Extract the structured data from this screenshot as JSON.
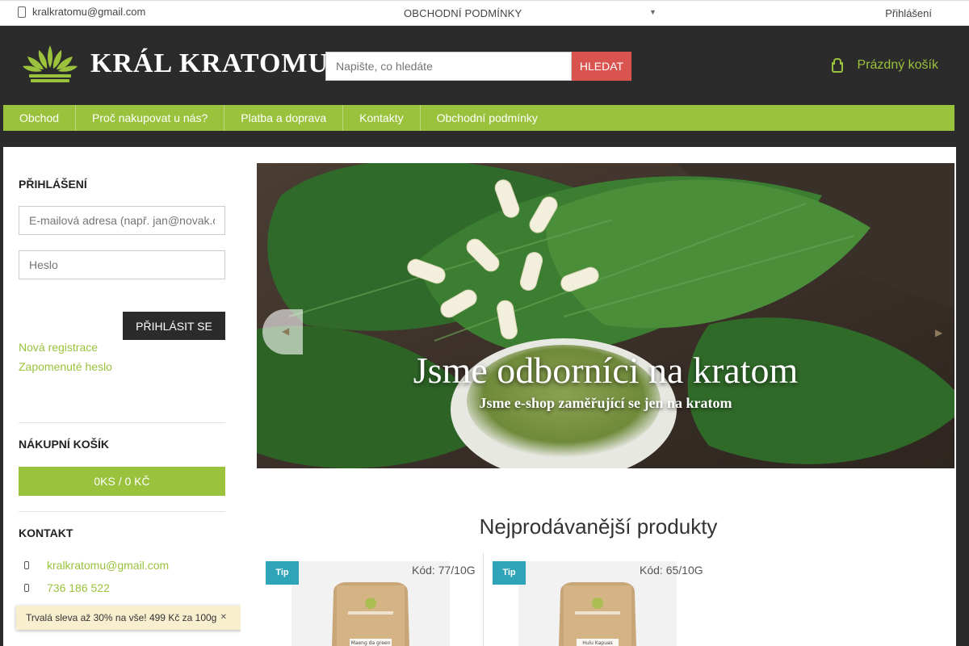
{
  "topbar": {
    "email": "kralkratomu@gmail.com",
    "terms": "OBCHODNÍ PODMÍNKY",
    "login": "Přihlášení"
  },
  "header": {
    "logo_text": "KRÁL KRATOMU",
    "search_placeholder": "Napište, co hledáte",
    "search_button": "HLEDAT",
    "cart_label": "Prázdný košík"
  },
  "nav": {
    "items": [
      "Obchod",
      "Proč nakupovat u nás?",
      "Platba a doprava",
      "Kontakty",
      "Obchodní podmínky"
    ]
  },
  "sidebar": {
    "login_title": "PŘIHLÁŠENÍ",
    "email_placeholder": "E-mailová adresa (např. jan@novak.cz)",
    "password_placeholder": "Heslo",
    "login_button": "PŘIHLÁSIT SE",
    "register_link": "Nová registrace",
    "forgot_link": "Zapomenuté heslo",
    "cart_title": "NÁKUPNÍ KOŠÍK",
    "cart_summary": "0KS / 0 KČ",
    "contact_title": "KONTAKT",
    "contact_email": "kralkratomu@gmail.com",
    "contact_phone": "736 186 522"
  },
  "promo": {
    "text": "Trvalá sleva až 30% na vše! 499 Kč za 100g"
  },
  "banner": {
    "title": "Jsme odborníci na kratom",
    "subtitle": "Jsme e-shop zaměřující se jen na kratom"
  },
  "main": {
    "bestsellers_title": "Nejprodávanější produkty",
    "products": [
      {
        "badge": "Tip",
        "code": "Kód: 77/10G",
        "pack_label": "Maeng da green"
      },
      {
        "badge": "Tip",
        "code": "Kód: 65/10G",
        "pack_label": "Hulu Kapuas"
      }
    ]
  },
  "colors": {
    "accent_green": "#9ac23c",
    "search_red": "#d9534f",
    "tip_blue": "#2fa4b8",
    "header_dark": "#2b2b2b"
  }
}
